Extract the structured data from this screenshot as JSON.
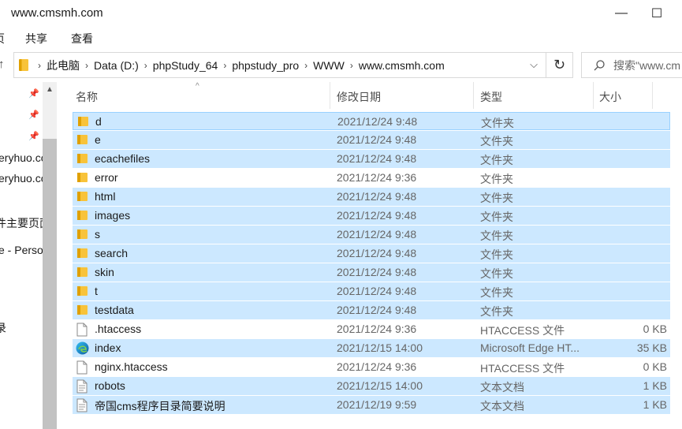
{
  "window": {
    "title": "www.cmsmh.com",
    "minimize": "—",
    "maximize": "☐"
  },
  "ribbon": {
    "tabs": [
      "页",
      "共享",
      "查看"
    ]
  },
  "address": {
    "up": "↑",
    "crumbs": [
      "此电脑",
      "Data (D:)",
      "phpStudy_64",
      "phpstudy_pro",
      "WWW",
      "www.cmsmh.com"
    ],
    "dropdown": "⌵",
    "refresh": "↻"
  },
  "search": {
    "placeholder": "搜索\"www.cm"
  },
  "navpane": {
    "items": [
      "eryhuo.cc",
      "eryhuo.cc",
      "件主要页面",
      "e - Perso",
      "t",
      "录"
    ]
  },
  "columns": {
    "name": "名称",
    "date": "修改日期",
    "type": "类型",
    "size": "大小"
  },
  "files": [
    {
      "name": "d",
      "date": "2021/12/24 9:48",
      "type": "文件夹",
      "size": "",
      "icon": "folder-icon",
      "selected": true
    },
    {
      "name": "e",
      "date": "2021/12/24 9:48",
      "type": "文件夹",
      "size": "",
      "icon": "folder-icon",
      "selected": true
    },
    {
      "name": "ecachefiles",
      "date": "2021/12/24 9:48",
      "type": "文件夹",
      "size": "",
      "icon": "folder-icon",
      "selected": true
    },
    {
      "name": "error",
      "date": "2021/12/24 9:36",
      "type": "文件夹",
      "size": "",
      "icon": "folder-icon",
      "selected": false
    },
    {
      "name": "html",
      "date": "2021/12/24 9:48",
      "type": "文件夹",
      "size": "",
      "icon": "folder-icon",
      "selected": true
    },
    {
      "name": "images",
      "date": "2021/12/24 9:48",
      "type": "文件夹",
      "size": "",
      "icon": "folder-icon",
      "selected": true
    },
    {
      "name": "s",
      "date": "2021/12/24 9:48",
      "type": "文件夹",
      "size": "",
      "icon": "folder-icon",
      "selected": true
    },
    {
      "name": "search",
      "date": "2021/12/24 9:48",
      "type": "文件夹",
      "size": "",
      "icon": "folder-icon",
      "selected": true
    },
    {
      "name": "skin",
      "date": "2021/12/24 9:48",
      "type": "文件夹",
      "size": "",
      "icon": "folder-icon",
      "selected": true
    },
    {
      "name": "t",
      "date": "2021/12/24 9:48",
      "type": "文件夹",
      "size": "",
      "icon": "folder-icon",
      "selected": true
    },
    {
      "name": "testdata",
      "date": "2021/12/24 9:48",
      "type": "文件夹",
      "size": "",
      "icon": "folder-icon",
      "selected": true
    },
    {
      "name": ".htaccess",
      "date": "2021/12/24 9:36",
      "type": "HTACCESS 文件",
      "size": "0 KB",
      "icon": "file-icon",
      "selected": false
    },
    {
      "name": "index",
      "date": "2021/12/15 14:00",
      "type": "Microsoft Edge HT...",
      "size": "35 KB",
      "icon": "edge-icon",
      "selected": true
    },
    {
      "name": "nginx.htaccess",
      "date": "2021/12/24 9:36",
      "type": "HTACCESS 文件",
      "size": "0 KB",
      "icon": "file-icon",
      "selected": false
    },
    {
      "name": "robots",
      "date": "2021/12/15 14:00",
      "type": "文本文档",
      "size": "1 KB",
      "icon": "text-file-icon",
      "selected": true
    },
    {
      "name": "帝国cms程序目录简要说明",
      "date": "2021/12/19 9:59",
      "type": "文本文档",
      "size": "1 KB",
      "icon": "text-file-icon",
      "selected": true
    }
  ],
  "colors": {
    "selection": "#cce8ff",
    "focus_border": "#99d1ff",
    "folder": "#f8c33a"
  }
}
